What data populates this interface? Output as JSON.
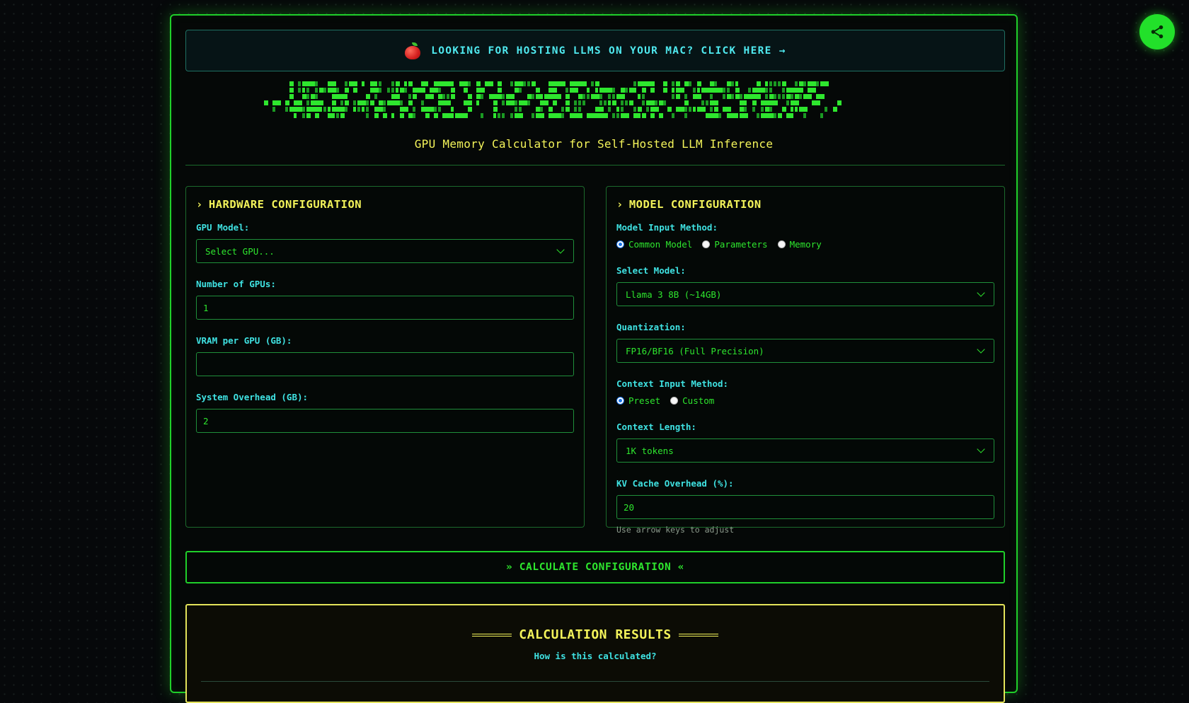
{
  "banner": {
    "text": "LOOKING FOR HOSTING LLMS ON YOUR MAC? CLICK HERE →",
    "icon": "apple-icon"
  },
  "header": {
    "subtitle": "GPU Memory Calculator for Self-Hosted LLM Inference",
    "logo_art": "ascii-logo"
  },
  "hardware": {
    "title": "HARDWARE CONFIGURATION",
    "gpu_model_label": "GPU Model:",
    "gpu_model_value": "Select GPU...",
    "num_gpus_label": "Number of GPUs:",
    "num_gpus_value": "1",
    "vram_label": "VRAM per GPU (GB):",
    "vram_value": "",
    "overhead_label": "System Overhead (GB):",
    "overhead_value": "2"
  },
  "model": {
    "title": "MODEL CONFIGURATION",
    "input_method_label": "Model Input Method:",
    "input_methods": [
      "Common Model",
      "Parameters",
      "Memory"
    ],
    "input_method_selected": "Common Model",
    "select_model_label": "Select Model:",
    "select_model_value": "Llama 3 8B (~14GB)",
    "quant_label": "Quantization:",
    "quant_value": "FP16/BF16 (Full Precision)",
    "context_method_label": "Context Input Method:",
    "context_methods": [
      "Preset",
      "Custom"
    ],
    "context_method_selected": "Preset",
    "context_length_label": "Context Length:",
    "context_length_value": "1K tokens",
    "kv_label": "KV Cache Overhead (%):",
    "kv_value": "20",
    "kv_hint": "Use arrow keys to adjust"
  },
  "actions": {
    "calculate": "» CALCULATE CONFIGURATION «"
  },
  "results": {
    "title": "CALCULATION RESULTS",
    "how_link": "How is this calculated?"
  },
  "colors": {
    "accent_green": "#2ee62e",
    "cyan": "#3fe2e2",
    "yellow": "#f3f35a",
    "background": "#06080a"
  }
}
